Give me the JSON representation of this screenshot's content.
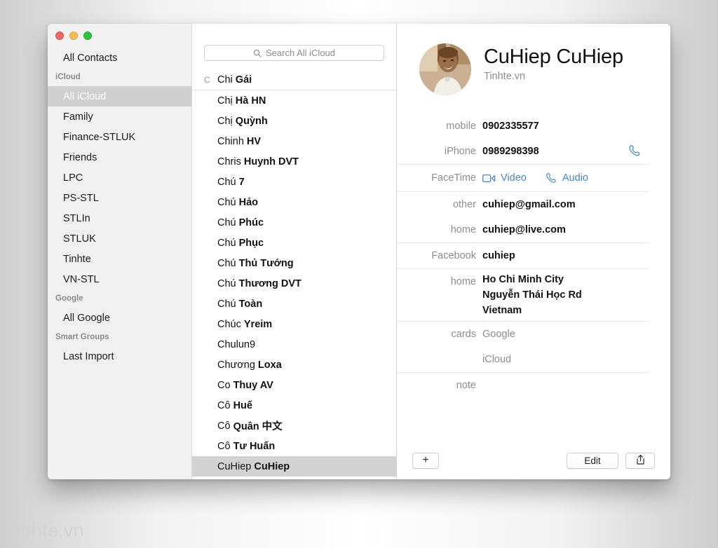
{
  "watermark": "Tinhte.vn",
  "sidebar": {
    "all_contacts": "All Contacts",
    "groups": [
      {
        "type": "header",
        "label": "iCloud"
      },
      {
        "type": "item",
        "label": "All iCloud",
        "selected": true
      },
      {
        "type": "item",
        "label": "Family",
        "selected": false
      },
      {
        "type": "item",
        "label": "Finance-STLUK",
        "selected": false
      },
      {
        "type": "item",
        "label": "Friends",
        "selected": false
      },
      {
        "type": "item",
        "label": "LPC",
        "selected": false
      },
      {
        "type": "item",
        "label": "PS-STL",
        "selected": false
      },
      {
        "type": "item",
        "label": "STLIn",
        "selected": false
      },
      {
        "type": "item",
        "label": "STLUK",
        "selected": false
      },
      {
        "type": "item",
        "label": "Tinhte",
        "selected": false
      },
      {
        "type": "item",
        "label": "VN-STL",
        "selected": false
      },
      {
        "type": "header",
        "label": "Google"
      },
      {
        "type": "item",
        "label": "All Google",
        "selected": false
      },
      {
        "type": "header",
        "label": "Smart Groups"
      },
      {
        "type": "item",
        "label": "Last Import",
        "selected": false
      }
    ]
  },
  "search": {
    "placeholder": "Search All iCloud",
    "value": "",
    "icon": "search-icon"
  },
  "contacts": {
    "index_letter": "C",
    "rows": [
      {
        "first": "Chi",
        "last": "Gái",
        "index": "C",
        "rule": true,
        "selected": false
      },
      {
        "first": "Chị",
        "last": "Hà HN",
        "index": "",
        "rule": false,
        "selected": false
      },
      {
        "first": "Chị",
        "last": "Quỳnh",
        "index": "",
        "rule": false,
        "selected": false
      },
      {
        "first": "Chinh",
        "last": "HV",
        "index": "",
        "rule": false,
        "selected": false
      },
      {
        "first": "Chris",
        "last": "Huynh DVT",
        "index": "",
        "rule": false,
        "selected": false
      },
      {
        "first": "Chú",
        "last": "7",
        "index": "",
        "rule": false,
        "selected": false
      },
      {
        "first": "Chú",
        "last": "Hảo",
        "index": "",
        "rule": false,
        "selected": false
      },
      {
        "first": "Chú",
        "last": "Phúc",
        "index": "",
        "rule": false,
        "selected": false
      },
      {
        "first": "Chú",
        "last": "Phục",
        "index": "",
        "rule": false,
        "selected": false
      },
      {
        "first": "Chú",
        "last": "Thủ Tướng",
        "index": "",
        "rule": false,
        "selected": false
      },
      {
        "first": "Chú",
        "last": "Thương DVT",
        "index": "",
        "rule": false,
        "selected": false
      },
      {
        "first": "Chú",
        "last": "Toàn",
        "index": "",
        "rule": false,
        "selected": false
      },
      {
        "first": "Chúc",
        "last": "Yreim",
        "index": "",
        "rule": false,
        "selected": false
      },
      {
        "first": "Chulun9",
        "last": "",
        "index": "",
        "rule": false,
        "selected": false
      },
      {
        "first": "Chương",
        "last": "Loxa",
        "index": "",
        "rule": false,
        "selected": false
      },
      {
        "first": "Co",
        "last": "Thuy AV",
        "index": "",
        "rule": false,
        "selected": false
      },
      {
        "first": "Cô",
        "last": "Huế",
        "index": "",
        "rule": false,
        "selected": false
      },
      {
        "first": "Cô",
        "last": "Quân 中文",
        "index": "",
        "rule": false,
        "selected": false
      },
      {
        "first": "Cô",
        "last": "Tư Huấn",
        "index": "",
        "rule": false,
        "selected": false
      },
      {
        "first": "CuHiep",
        "last": "CuHiep",
        "index": "",
        "rule": false,
        "selected": true
      }
    ]
  },
  "detail": {
    "name": "CuHiep CuHiep",
    "organization": "Tinhte.vn",
    "avatar_icon": "contact-photo",
    "phones": [
      {
        "label": "mobile",
        "value": "0902335577",
        "action": ""
      },
      {
        "label": "iPhone",
        "value": "0989298398",
        "action": "call-icon"
      }
    ],
    "facetime": {
      "label": "FaceTime",
      "video_label": "Video",
      "audio_label": "Audio",
      "video_icon": "video-camera-icon",
      "audio_icon": "phone-handset-icon"
    },
    "emails": [
      {
        "label": "other",
        "value": "cuhiep@gmail.com"
      },
      {
        "label": "home",
        "value": "cuhiep@live.com"
      }
    ],
    "social": [
      {
        "label": "Facebook",
        "value": "cuhiep"
      }
    ],
    "address": {
      "label": "home",
      "lines": [
        "Ho Chi Minh City",
        "Nguyễn Thái Học Rd",
        "Vietnam"
      ]
    },
    "cards": {
      "label": "cards",
      "values": [
        "Google",
        "iCloud"
      ]
    },
    "note": {
      "label": "note",
      "value": ""
    },
    "footer": {
      "add_label": "+",
      "edit_label": "Edit",
      "share_icon": "share-icon"
    }
  },
  "colors": {
    "accent_blue": "#4b86bd",
    "selection_gray": "#d2d2d2",
    "sidebar_bg": "#f1f1f1",
    "label_gray": "#8d8d8d"
  }
}
